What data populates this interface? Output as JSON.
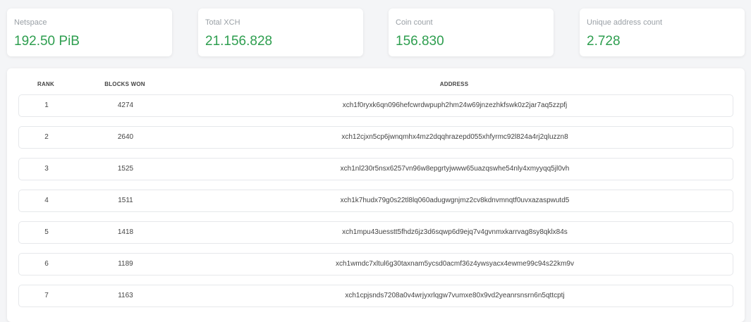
{
  "stats": [
    {
      "label": "Netspace",
      "value": "192.50 PiB"
    },
    {
      "label": "Total XCH",
      "value": "21.156.828"
    },
    {
      "label": "Coin count",
      "value": "156.830"
    },
    {
      "label": "Unique address count",
      "value": "2.728"
    }
  ],
  "table": {
    "headers": {
      "rank": "RANK",
      "blocks": "BLOCKS WON",
      "address": "ADDRESS"
    },
    "rows": [
      {
        "rank": "1",
        "blocks": "4274",
        "address": "xch1f0ryxk6qn096hefcwrdwpuph2hm24w69jnzezhkfswk0z2jar7aq5zzpfj"
      },
      {
        "rank": "2",
        "blocks": "2640",
        "address": "xch12cjxn5cp6jwnqmhx4mz2dqqhrazepd055xhfyrmc92l824a4rj2qluzzn8"
      },
      {
        "rank": "3",
        "blocks": "1525",
        "address": "xch1nl230r5nsx6257vn96w8epgrtyjwww65uazqswhe54nly4xmyyqq5jl0vh"
      },
      {
        "rank": "4",
        "blocks": "1511",
        "address": "xch1k7hudx79g0s22tl8lq060adugwgnjmz2cv8kdnvmnqtf0uvxazaspwutd5"
      },
      {
        "rank": "5",
        "blocks": "1418",
        "address": "xch1mpu43uesstt5fhdz6jz3d6sqwp6d9ejq7v4gvnmxkarrvag8sy8qklx84s"
      },
      {
        "rank": "6",
        "blocks": "1189",
        "address": "xch1wmdc7xltul6g30taxnam5ycsd0acmf36z4ywsyacx4ewme99c94s22km9v"
      },
      {
        "rank": "7",
        "blocks": "1163",
        "address": "xch1cpjsnds7208a0v4wrjyxrlqgw7vumxe80x9vd2yeanrsnsrn6n5qttcptj"
      }
    ]
  }
}
